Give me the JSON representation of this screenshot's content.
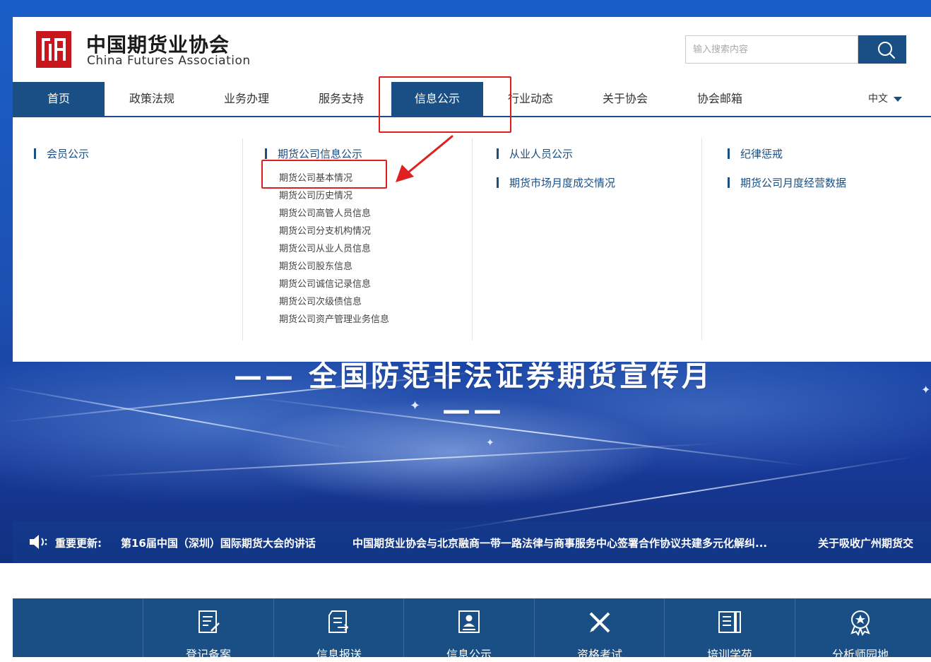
{
  "brand": {
    "name_cn": "中国期货业协会",
    "name_en": "China Futures Association",
    "logo_color": "#c8161e"
  },
  "search": {
    "placeholder": "输入搜索内容",
    "icon": "search-icon"
  },
  "nav": {
    "items": [
      {
        "label": "首页",
        "active": false
      },
      {
        "label": "政策法规",
        "active": false
      },
      {
        "label": "业务办理",
        "active": false
      },
      {
        "label": "服务支持",
        "active": false
      },
      {
        "label": "信息公示",
        "active": true
      },
      {
        "label": "行业动态",
        "active": false
      },
      {
        "label": "关于协会",
        "active": false
      },
      {
        "label": "协会邮箱",
        "active": false
      }
    ],
    "language": "中文",
    "accent_color": "#1a4f85"
  },
  "mega_menu": {
    "col1": {
      "sections": [
        "会员公示"
      ]
    },
    "col2": {
      "title": "期货公司信息公示",
      "items": [
        "期货公司基本情况",
        "期货公司历史情况",
        "期货公司高管人员信息",
        "期货公司分支机构情况",
        "期货公司从业人员信息",
        "期货公司股东信息",
        "期货公司诚信记录信息",
        "期货公司次级债信息",
        "期货公司资产管理业务信息"
      ]
    },
    "col3": {
      "sections": [
        "从业人员公示",
        "期货市场月度成交情况"
      ]
    },
    "col4": {
      "sections": [
        "纪律惩戒",
        "期货公司月度经营数据"
      ]
    }
  },
  "banner": {
    "slogan": "—— 全国防范非法证券期货宣传月 ——"
  },
  "ticker": {
    "label": "重要更新:",
    "items": [
      "第16届中国（深圳）国际期货大会的讲话",
      "中国期货业协会与北京融商一带一路法律与商事服务中心签署合作协议共建多元化解纠...",
      "关于吸收广州期货交"
    ]
  },
  "services": [
    {
      "label": "登记备案",
      "icon": "form-edit-icon"
    },
    {
      "label": "信息报送",
      "icon": "report-submit-icon"
    },
    {
      "label": "信息公示",
      "icon": "id-card-icon"
    },
    {
      "label": "资格考试",
      "icon": "pencil-ruler-icon"
    },
    {
      "label": "培训学苑",
      "icon": "books-icon"
    },
    {
      "label": "分析师园地",
      "icon": "award-badge-icon"
    }
  ],
  "annotation_color": "#e02020"
}
